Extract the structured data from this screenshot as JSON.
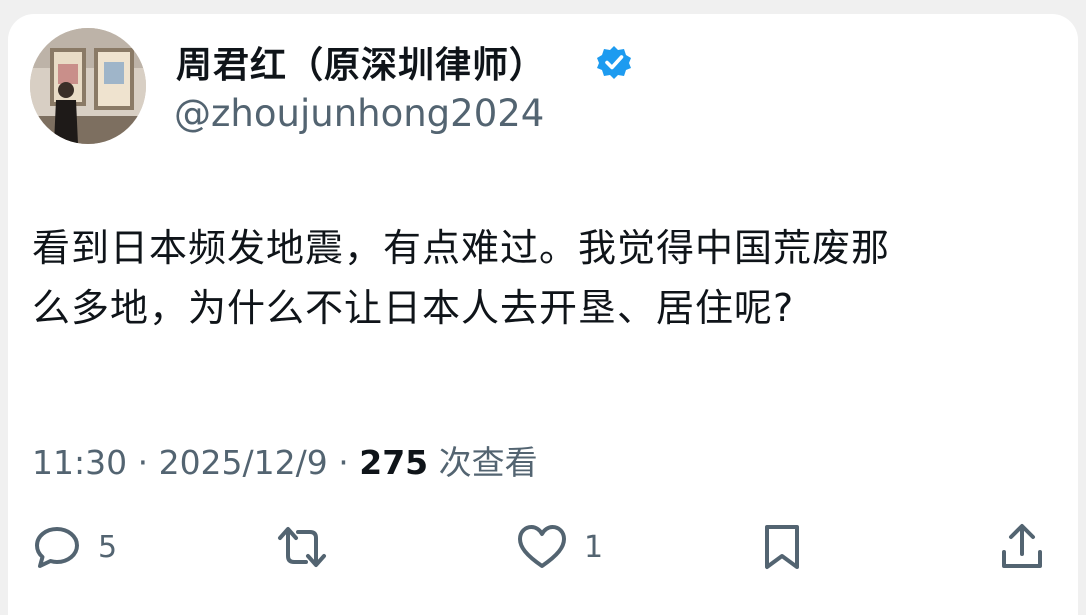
{
  "user": {
    "display_name": "周君红（原深圳律师）",
    "handle": "@zhoujunhong2024",
    "verified": true
  },
  "tweet": {
    "line1": "看到日本频发地震，有点难过。我觉得中国荒废那",
    "line2": "么多地，为什么不让日本人去开垦、居住呢?"
  },
  "meta": {
    "time": "11:30 · 2025/12/9 · ",
    "views_count": "275",
    "views_label": " 次查看"
  },
  "actions": {
    "reply_count": "5",
    "like_count": "1"
  },
  "colors": {
    "verified_blue": "#1d9bf0",
    "secondary_text": "#536471",
    "primary_text": "#0f1419"
  }
}
